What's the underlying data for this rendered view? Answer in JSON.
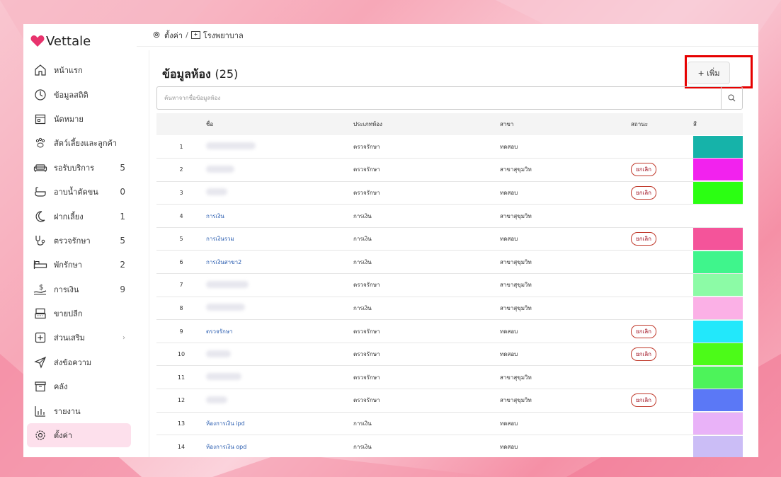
{
  "app": {
    "logo_text": "Vettale",
    "accent": "#e8336d"
  },
  "breadcrumb": {
    "item1": "ตั้งค่า",
    "separator": "/",
    "item2": "โรงพยาบาล"
  },
  "sidebar": {
    "items": [
      {
        "label": "หน้าแรก",
        "count": "",
        "icon": "home-icon"
      },
      {
        "label": "ข้อมูลสถิติ",
        "count": "",
        "icon": "stats-icon"
      },
      {
        "label": "นัดหมาย",
        "count": "",
        "icon": "calendar-icon"
      },
      {
        "label": "สัตว์เลี้ยงและลูกค้า",
        "count": "",
        "icon": "paw-icon"
      },
      {
        "label": "รอรับบริการ",
        "count": "5",
        "icon": "sofa-icon"
      },
      {
        "label": "อาบน้ำตัดขน",
        "count": "0",
        "icon": "bathtub-icon"
      },
      {
        "label": "ฝากเลี้ยง",
        "count": "1",
        "icon": "moon-icon"
      },
      {
        "label": "ตรวจรักษา",
        "count": "5",
        "icon": "stethoscope-icon"
      },
      {
        "label": "พักรักษา",
        "count": "2",
        "icon": "bed-icon"
      },
      {
        "label": "การเงิน",
        "count": "9",
        "icon": "money-icon"
      },
      {
        "label": "ขายปลีก",
        "count": "",
        "icon": "register-icon"
      },
      {
        "label": "ส่วนเสริม",
        "count": "",
        "icon": "plus-box-icon",
        "chevron": "›"
      },
      {
        "label": "ส่งข้อความ",
        "count": "",
        "icon": "send-icon"
      },
      {
        "label": "คลัง",
        "count": "",
        "icon": "archive-icon"
      },
      {
        "label": "รายงาน",
        "count": "",
        "icon": "report-icon"
      },
      {
        "label": "ตั้งค่า",
        "count": "",
        "icon": "gear-icon",
        "active": true
      }
    ]
  },
  "main": {
    "title": "ข้อมูลห้อง",
    "count": "(25)",
    "add_button": "+ เพิ่ม",
    "search_placeholder": "ค้นหาจากชื่อข้อมูลห้อง",
    "columns": [
      "ชื่อ",
      "ประเภทห้อง",
      "สาขา",
      "สถานะ",
      "สี"
    ],
    "rows": [
      {
        "num": "1",
        "name": "",
        "type": "ตรวจรักษา",
        "branch": "ทดสอบ",
        "status": "",
        "color": "#16b3a9"
      },
      {
        "num": "2",
        "name": "",
        "type": "ตรวจรักษา",
        "branch": "สาขาสุขุมวิท",
        "status": "ยกเลิก",
        "color": "#f222ee"
      },
      {
        "num": "3",
        "name": "",
        "type": "ตรวจรักษา",
        "branch": "ทดสอบ",
        "status": "ยกเลิก",
        "color": "#2bff12"
      },
      {
        "num": "4",
        "name": "การเงิน",
        "type": "การเงิน",
        "branch": "สาขาสุขุมวิท",
        "status": "",
        "color": ""
      },
      {
        "num": "5",
        "name": "การเงินรวม",
        "type": "การเงิน",
        "branch": "ทดสอบ",
        "status": "ยกเลิก",
        "color": "#f4549a"
      },
      {
        "num": "6",
        "name": "การเงินสาขา2",
        "type": "การเงิน",
        "branch": "สาขาสุขุมวิท",
        "status": "",
        "color": "#3ff58c"
      },
      {
        "num": "7",
        "name": "",
        "type": "ตรวจรักษา",
        "branch": "สาขาสุขุมวิท",
        "status": "",
        "color": "#8cfba6"
      },
      {
        "num": "8",
        "name": "",
        "type": "การเงิน",
        "branch": "สาขาสุขุมวิท",
        "status": "",
        "color": "#fbb0e6"
      },
      {
        "num": "9",
        "name": "ตรวจรักษา",
        "type": "ตรวจรักษา",
        "branch": "ทดสอบ",
        "status": "ยกเลิก",
        "color": "#22e8fb"
      },
      {
        "num": "10",
        "name": "",
        "type": "ตรวจรักษา",
        "branch": "ทดสอบ",
        "status": "ยกเลิก",
        "color": "#4cfb18"
      },
      {
        "num": "11",
        "name": "",
        "type": "ตรวจรักษา",
        "branch": "สาขาสุขุมวิท",
        "status": "",
        "color": "#4df35a"
      },
      {
        "num": "12",
        "name": "",
        "type": "ตรวจรักษา",
        "branch": "สาขาสุขุมวิท",
        "status": "ยกเลิก",
        "color": "#5b78f6"
      },
      {
        "num": "13",
        "name": "ห้องการเงิน ipd",
        "type": "การเงิน",
        "branch": "ทดสอบ",
        "status": "",
        "color": "#e9b2f8"
      },
      {
        "num": "14",
        "name": "ห้องการเงิน opd",
        "type": "การเงิน",
        "branch": "ทดสอบ",
        "status": "",
        "color": "#cbbdf6"
      }
    ]
  }
}
